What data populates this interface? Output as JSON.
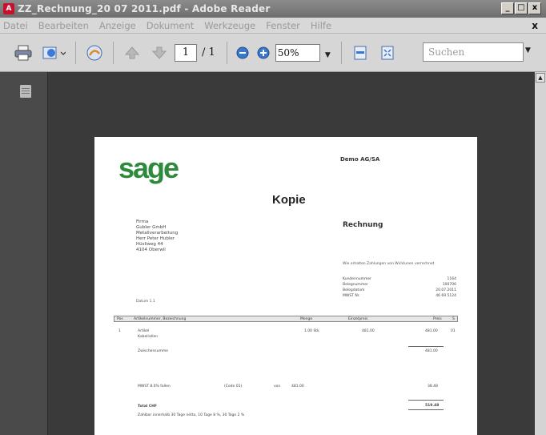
{
  "window": {
    "title": "ZZ_Rechnung_20 07 2011.pdf - Adobe Reader",
    "buttons": [
      "_",
      "□",
      "x"
    ]
  },
  "menu": {
    "items": [
      "Datei",
      "Bearbeiten",
      "Anzeige",
      "Dokument",
      "Werkzeuge",
      "Fenster",
      "Hilfe"
    ],
    "close": "x"
  },
  "toolbar": {
    "page_current": "1",
    "page_total": "/ 1",
    "zoom": "50%",
    "search_placeholder": "Suchen"
  },
  "icons": {
    "print": "printer-icon",
    "share": "share-icon",
    "collaborate": "collaborate-icon",
    "prev_page": "arrow-up-icon",
    "next_page": "arrow-down-icon",
    "zoom_out": "minus-circle-icon",
    "zoom_in": "plus-circle-icon",
    "fit_width": "fit-width-icon",
    "fit_page": "fit-page-icon",
    "pages_panel": "pages-icon"
  },
  "document": {
    "logo": "sage",
    "company": "Demo AG/SA",
    "stamp": "Kopie",
    "doc_type": "Rechnung",
    "address": [
      "Firma",
      "Gubler GmbH",
      "Metallverarbeitung",
      "Herr Peter Hubler",
      "Hüsliweg 44",
      "4104 Oberwil"
    ],
    "note": "Wie erhalten Zahlungen von Wicklunen verrechnet",
    "info": [
      {
        "label": "Kundennummer",
        "value": "1164"
      },
      {
        "label": "Belegnummer",
        "value": "100706"
      },
      {
        "label": "Belegdatum",
        "value": "20.07.2011"
      },
      {
        "label": "MWST Nr.",
        "value": "46 69 5124"
      }
    ],
    "date_line": "Datum 1.1",
    "table_header": [
      "Pos",
      "Artikelnummer, Bezeichnung",
      "Menge",
      "Einzelpreis",
      "Preis",
      "S"
    ],
    "item": {
      "pos": "1",
      "desc": "Artikel",
      "sub": "Kabelrollen",
      "menge": "1.00 Stk",
      "einzel": "481.00",
      "preis": "481.00",
      "s": "01"
    },
    "zwischensumme_label": "Zwischensumme",
    "zwischensumme": "481.00",
    "mwst_label": "MWST 8.0% fallen",
    "mwst_code": "(Code 01)",
    "mwst_auf": "von",
    "mwst_base": "481.00",
    "mwst_value": "38.48",
    "total_label": "Total CHF",
    "total": "519.48",
    "terms": "Zahlbar innerhalb 30 Tage netto, 10 Tage 8 %, 30 Tage 2 %"
  }
}
